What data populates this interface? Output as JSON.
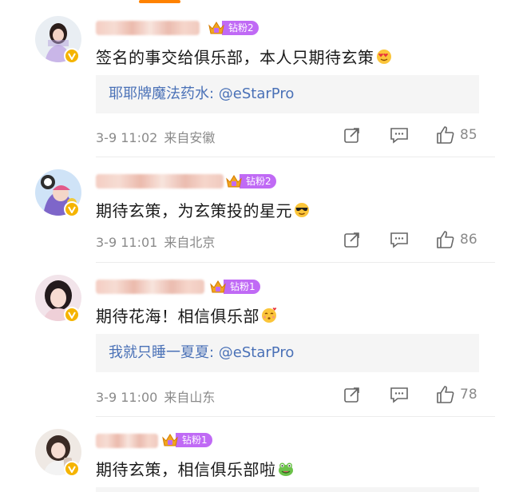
{
  "comments": [
    {
      "fan_badge": "钻粉2",
      "text": "签名的事交给俱乐部，本人只期待玄策",
      "emoji": "heart-eyes-emoji",
      "reply": {
        "name": "耶耶牌魔法药水",
        "text": ": @eStarPro"
      },
      "date": "3-9 11:02",
      "location": "来自安徽",
      "likes": "85"
    },
    {
      "fan_badge": "钻粉2",
      "text": "期待玄策，为玄策投的星元",
      "emoji": "sunglasses-emoji",
      "date": "3-9 11:01",
      "location": "来自北京",
      "likes": "86"
    },
    {
      "fan_badge": "钻粉1",
      "text": "期待花海！相信俱乐部",
      "emoji": "kiss-hearts-emoji",
      "reply": {
        "name": "我就只睡一夏夏",
        "text": ": @eStarPro"
      },
      "date": "3-9 11:00",
      "location": "来自山东",
      "likes": "78"
    },
    {
      "fan_badge": "钻粉1",
      "text": "期待玄策，相信俱乐部啦",
      "emoji": "frog-emoji"
    }
  ],
  "colors": {
    "accent": "#ff8200",
    "fan_badge": "#c06af5",
    "reply_link": "#4a71b7",
    "meta_text": "#8a8a8a",
    "verified": "#f5b400"
  },
  "icons": {
    "share": "share-icon",
    "comment": "comment-icon",
    "like": "thumbs-up-icon"
  }
}
